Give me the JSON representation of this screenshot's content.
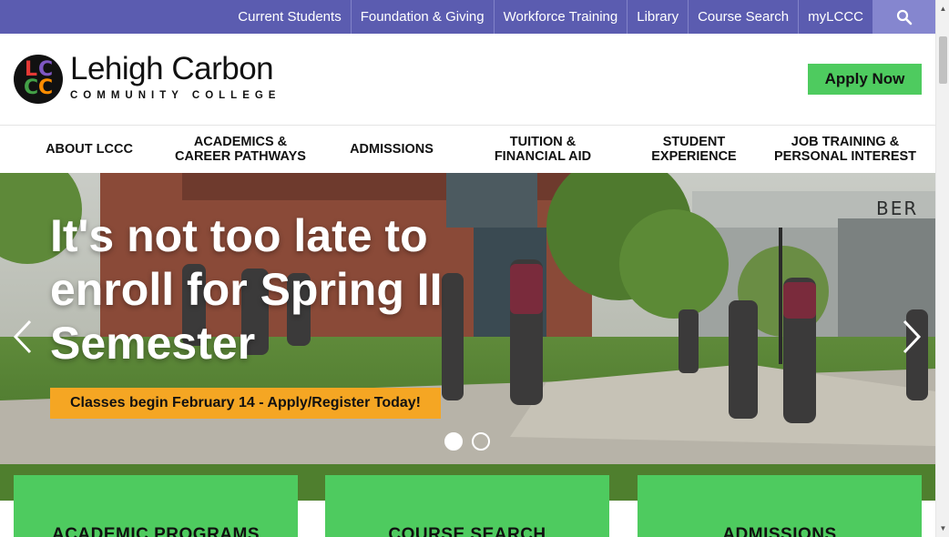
{
  "utility_nav": {
    "links": [
      "Current Students",
      "Foundation & Giving",
      "Workforce Training",
      "Library",
      "Course Search",
      "myLCCC"
    ],
    "search_icon": "search-icon"
  },
  "header": {
    "logo_letters": [
      "L",
      "C",
      "C",
      "C"
    ],
    "logo_colors": [
      "#e53935",
      "#7e57c2",
      "#43a047",
      "#fb8c00"
    ],
    "college_name": "Lehigh Carbon",
    "college_sub": "COMMUNITY COLLEGE",
    "apply_label": "Apply Now"
  },
  "main_nav": {
    "items": [
      {
        "line1": "ABOUT LCCC",
        "line2": ""
      },
      {
        "line1": "ACADEMICS &",
        "line2": "CAREER PATHWAYS"
      },
      {
        "line1": "ADMISSIONS",
        "line2": ""
      },
      {
        "line1": "TUITION &",
        "line2": "FINANCIAL AID"
      },
      {
        "line1": "STUDENT",
        "line2": "EXPERIENCE"
      },
      {
        "line1": "JOB TRAINING &",
        "line2": "PERSONAL INTEREST"
      }
    ]
  },
  "hero": {
    "title": "It's not too late to enroll for Spring II Semester",
    "cta": "Classes begin February 14 - Apply/Register Today!",
    "building_sign": "BER",
    "slide_count": 2,
    "active_slide": 1
  },
  "cards": [
    {
      "label": "ACADEMIC PROGRAMS"
    },
    {
      "label": "COURSE SEARCH"
    },
    {
      "label": "ADMISSIONS"
    }
  ],
  "colors": {
    "utility_bar": "#5b5cb0",
    "accent_green": "#4ecb5f",
    "cta_orange": "#f5a623"
  }
}
